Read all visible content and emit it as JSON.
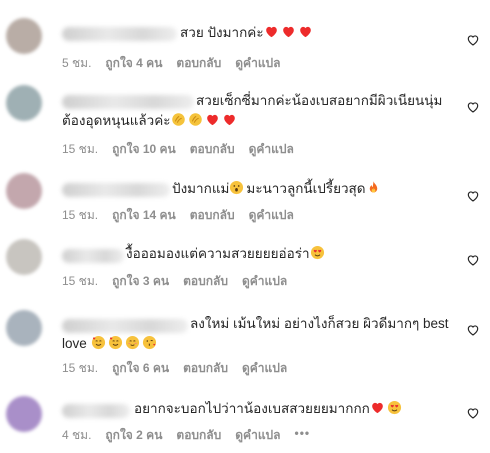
{
  "colors": {
    "text": "#262626",
    "meta": "#8e8e8e",
    "heart": "#ed2b2b"
  },
  "comments": [
    {
      "avatar_color": "#b9ada6",
      "text": "สวย  ปังมากค่ะ",
      "emojis": [
        "red-heart-emoji",
        "red-heart-emoji",
        "red-heart-emoji"
      ],
      "time": "5 ชม.",
      "likes": "ถูกใจ 4 คน",
      "reply": "ตอบกลับ",
      "translate": "ดูคำแปล"
    },
    {
      "avatar_color": "#9fb0b4",
      "text_line1": "สวยเซ็กซี่มากค่ะน้องเบสอยากมีผิวเนียนนุ่ม",
      "text_line2": "ต้องอุดหนุนแล้วค่ะ",
      "emojis": [
        "clapping-hands-emoji",
        "clapping-hands-emoji",
        "red-heart-emoji",
        "red-heart-emoji"
      ],
      "time": "15 ชม.",
      "likes": "ถูกใจ 10 คน",
      "reply": "ตอบกลับ",
      "translate": "ดูคำแปล"
    },
    {
      "avatar_color": "#c3a7ad",
      "text": "ปังมากแม่",
      "text_after": "มะนาวลูกนี้เปรี้ยวสุด",
      "emojis": [
        "astonished-face-emoji",
        "fire-emoji"
      ],
      "time": "15 ชม.",
      "likes": "ถูกใจ 14 คน",
      "reply": "ตอบกลับ",
      "translate": "ดูคำแปล"
    },
    {
      "avatar_color": "#c8c5c0",
      "text": "งื้อออมองแต่ความสวยยยยอ่อร่า",
      "emojis": [
        "heart-eyes-emoji"
      ],
      "time": "15 ชม.",
      "likes": "ถูกใจ 3 คน",
      "reply": "ตอบกลับ",
      "translate": "ดูคำแปล"
    },
    {
      "avatar_color": "#a9b3bd",
      "text_line1": "ลงใหม่ เม้นใหม่ อย่างไงก็สวย ผิวดีมากๆ best",
      "text_line2": "love",
      "emojis": [
        "smiling-hearts-emoji",
        "smiling-hearts-emoji",
        "blushing-emoji",
        "kissing-emoji"
      ],
      "time": "15 ชม.",
      "likes": "ถูกใจ 6 คน",
      "reply": "ตอบกลับ",
      "translate": "ดูคำแปล"
    },
    {
      "avatar_color": "#a98fc9",
      "text": "อยากจะบอกไปว่าาน้องเบสสวยยยมากกก",
      "emojis": [
        "red-heart-emoji",
        "heart-eyes-emoji"
      ],
      "time": "4 ชม.",
      "likes": "ถูกใจ 2 คน",
      "reply": "ตอบกลับ",
      "translate": "ดูคำแปล",
      "more": "•••"
    }
  ]
}
